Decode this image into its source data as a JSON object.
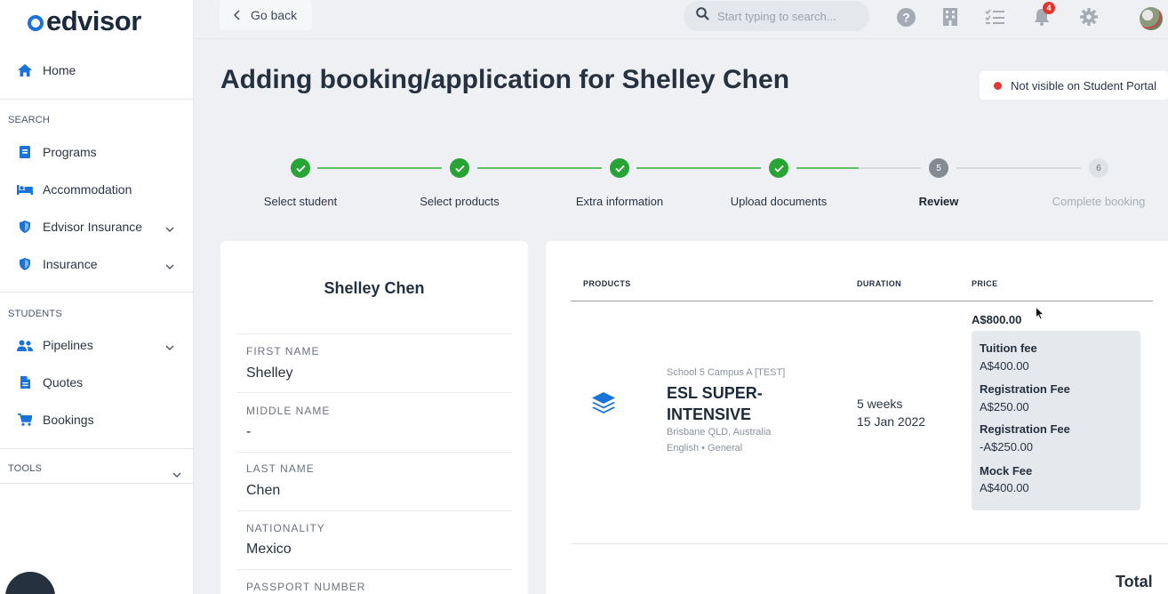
{
  "sidebar": {
    "logo": "edvisor",
    "home": "Home",
    "search_section": "SEARCH",
    "programs": "Programs",
    "accommodation": "Accommodation",
    "edvisor_insurance": "Edvisor Insurance",
    "insurance": "Insurance",
    "students_section": "STUDENTS",
    "pipelines": "Pipelines",
    "quotes": "Quotes",
    "bookings": "Bookings",
    "tools_section": "TOOLS"
  },
  "topbar": {
    "go_back": "Go back",
    "search_placeholder": "Start typing to search...",
    "notification_count": "4"
  },
  "header": {
    "title": "Adding booking/application for Shelley Chen",
    "visibility": "Not visible on Student Portal"
  },
  "stepper": {
    "steps": [
      {
        "label": "Select student",
        "status": "done"
      },
      {
        "label": "Select products",
        "status": "done"
      },
      {
        "label": "Extra information",
        "status": "done"
      },
      {
        "label": "Upload documents",
        "status": "done"
      },
      {
        "label": "Review",
        "status": "current",
        "number": "5"
      },
      {
        "label": "Complete booking",
        "status": "todo",
        "number": "6"
      }
    ]
  },
  "student": {
    "name": "Shelley Chen",
    "fields": [
      {
        "label": "FIRST NAME",
        "value": "Shelley"
      },
      {
        "label": "MIDDLE NAME",
        "value": "-"
      },
      {
        "label": "LAST NAME",
        "value": "Chen"
      },
      {
        "label": "NATIONALITY",
        "value": "Mexico"
      },
      {
        "label": "PASSPORT NUMBER",
        "value": ""
      }
    ]
  },
  "products": {
    "headers": {
      "products": "PRODUCTS",
      "duration": "DURATION",
      "price": "PRICE"
    },
    "item": {
      "school": "School 5 Campus A [TEST]",
      "title": "ESL SUPER-INTENSIVE",
      "location": "Brisbane QLD, Australia",
      "language": "English • General",
      "duration": "5 weeks",
      "start_date": "15 Jan 2022",
      "price": "A$800.00",
      "fees": [
        {
          "name": "Tuition fee",
          "amount": "A$400.00"
        },
        {
          "name": "Registration Fee",
          "amount": "A$250.00"
        },
        {
          "name": "Registration Fee",
          "amount": "-A$250.00"
        },
        {
          "name": "Mock Fee",
          "amount": "A$400.00"
        }
      ]
    },
    "total_label": "Total"
  },
  "colors": {
    "accent": "#1a73d9",
    "done": "#27a434",
    "alert": "#df3b30"
  }
}
